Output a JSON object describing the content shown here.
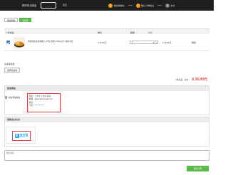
{
  "header": {
    "brand": "购好物 请慎选",
    "logo_text": "...",
    "back_link": "首页",
    "steps": [
      {
        "num": "1",
        "label": "我的购物车"
      },
      {
        "num": "2",
        "label": "确认订单信息"
      },
      {
        "num": "3",
        "label": "支付"
      }
    ]
  },
  "tabs": [
    "继续购物",
    "去结算"
  ],
  "cart_table": {
    "headers": {
      "product": "1件商品",
      "unit_price": "单价",
      "quantity": "数量",
      "subtotal": "小计"
    },
    "rows": [
      {
        "product_name": "新鲜蜂蜜自然熟橘子 2斤装 新果1.25kg(2斤) 顺丰冷链",
        "unit_price": "¥ 36.90元",
        "quantity": "1",
        "minus": "-",
        "plus": "+",
        "subtotal": "¥ 36.90元",
        "action": "删除"
      }
    ]
  },
  "coupon": {
    "label": "请选择优惠",
    "button": "选择优惠券"
  },
  "total": {
    "label": "1件商品，总价：",
    "amount": "¥ 36.90元"
  },
  "address": {
    "section_title": "配送地址",
    "option_label": "点击添加地址",
    "lines": [
      "地址：上海市 上海市 黄浦",
      "邮箱：admin@example.com",
      "姓名：",
      "手机：*** **** ****"
    ]
  },
  "payment": {
    "section_title": "选择支付方式",
    "alipay_cn": "支付宝",
    "alipay_en": "ALIPAY",
    "alipay_icon": "支"
  },
  "remark_placeholder": "留言备注",
  "submit_label": "提交订单"
}
